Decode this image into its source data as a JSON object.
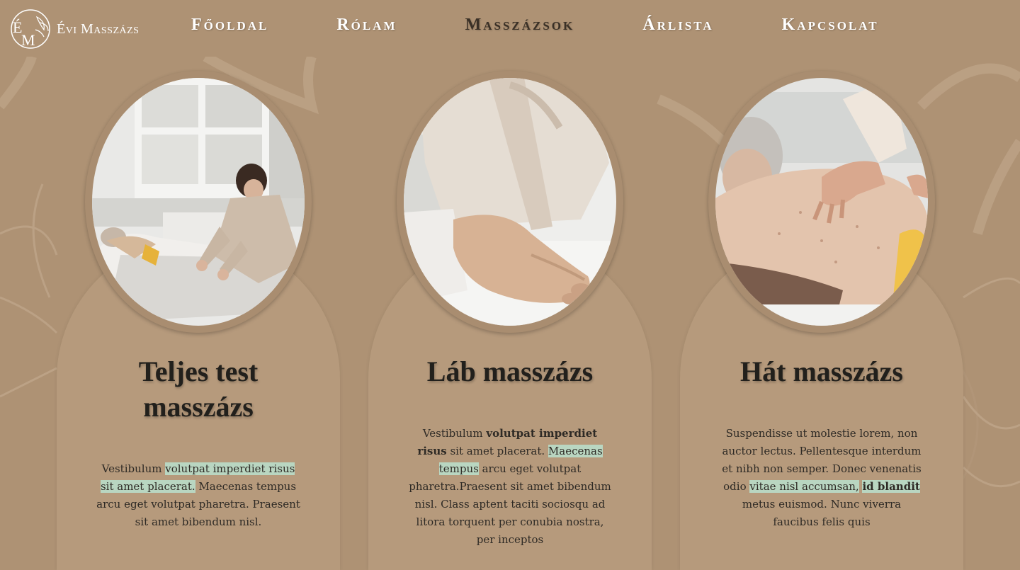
{
  "brand": {
    "name": "Évi Masszázs",
    "monogram": "ÉM"
  },
  "nav": {
    "items": [
      {
        "label": "Főoldal"
      },
      {
        "label": "Rólam"
      },
      {
        "label": "Masszázsok"
      },
      {
        "label": "Árlista"
      },
      {
        "label": "Kapcsolat"
      }
    ],
    "active_index": 2
  },
  "colors": {
    "background": "#ae9274",
    "card": "#b69a7c",
    "highlight": "#b9d6c1",
    "active_nav": "#3a3026"
  },
  "cards": [
    {
      "title": "Teljes test masszázs",
      "image": "full-body-massage-photo",
      "text": {
        "p1": "Vestibulum ",
        "p2": "volutpat imperdiet risus sit amet placerat.",
        "p3": " Maecenas tempus arcu eget volutpat pharetra. Praesent sit amet bibendum nisl."
      }
    },
    {
      "title": "Láb masszázs",
      "image": "foot-massage-photo",
      "text": {
        "p1": "Vestibulum ",
        "p2": "volutpat imperdiet risus",
        "p3": " sit amet placerat. ",
        "p4": "Maecenas tempus",
        "p5": " arcu eget volutpat pharetra.Praesent sit amet bibendum nisl. Class aptent taciti sociosqu ad litora torquent per conubia nostra, per inceptos"
      }
    },
    {
      "title": "Hát masszázs",
      "image": "back-massage-photo",
      "text": {
        "p1": "Suspendisse ut molestie lorem, non auctor lectus. Pellentesque interdum et nibh non semper. Donec venenatis odio ",
        "p2": "vitae nisl accumsan,",
        "p3": " ",
        "p4": "id blandit",
        "p5": " metus euismod. Nunc viverra faucibus felis quis"
      }
    }
  ]
}
